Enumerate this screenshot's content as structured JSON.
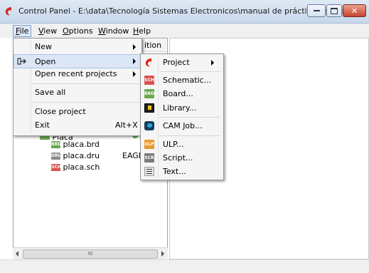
{
  "window": {
    "title": "Control Panel - E:\\data\\Tecnología Sistemas Electronicos\\manual de prácticas\\eagle\\Pla...",
    "accent": "#c7432c"
  },
  "menubar": {
    "items": [
      {
        "label": "File",
        "mnemonic": "F"
      },
      {
        "label": "View",
        "mnemonic": "V"
      },
      {
        "label": "Options",
        "mnemonic": "O"
      },
      {
        "label": "Window",
        "mnemonic": "W"
      },
      {
        "label": "Help",
        "mnemonic": "H"
      }
    ]
  },
  "file_menu": {
    "items": [
      {
        "label": "New",
        "submenu": true
      },
      {
        "label": "Open",
        "submenu": true,
        "highlighted": true,
        "icon": "open-arrow-icon"
      },
      {
        "label": "Open recent projects",
        "submenu": true
      },
      {
        "label": "Save all"
      },
      {
        "label": "Close project"
      },
      {
        "label": "Exit",
        "shortcut": "Alt+X"
      }
    ]
  },
  "open_menu": {
    "items": [
      {
        "label": "Project",
        "submenu": true,
        "icon": "eagle-logo-icon"
      },
      {
        "label": "Schematic...",
        "icon": "schematic-icon",
        "badge": "SCH"
      },
      {
        "label": "Board...",
        "icon": "board-icon",
        "badge": "BRD"
      },
      {
        "label": "Library...",
        "icon": "library-icon"
      },
      {
        "label": "CAM Job...",
        "icon": "cam-job-icon"
      },
      {
        "label": "ULP...",
        "icon": "ulp-icon",
        "badge": "ULP"
      },
      {
        "label": "Script...",
        "icon": "script-icon",
        "badge": "SCR"
      },
      {
        "label": "Text...",
        "icon": "text-icon"
      }
    ]
  },
  "tree": {
    "column_header": "ition",
    "partial_label": "Placa",
    "files": [
      {
        "name": "placa.brd",
        "badge": "BRD",
        "color": "#6aa84f"
      },
      {
        "name": "placa.dru",
        "badge": "DRU",
        "color": "#6d6d6d",
        "desc": "EAGLE"
      },
      {
        "name": "placa.sch",
        "badge": "SCH",
        "color": "#d9534f"
      }
    ]
  },
  "scrollbar": {
    "thumb_glyph": "III"
  }
}
